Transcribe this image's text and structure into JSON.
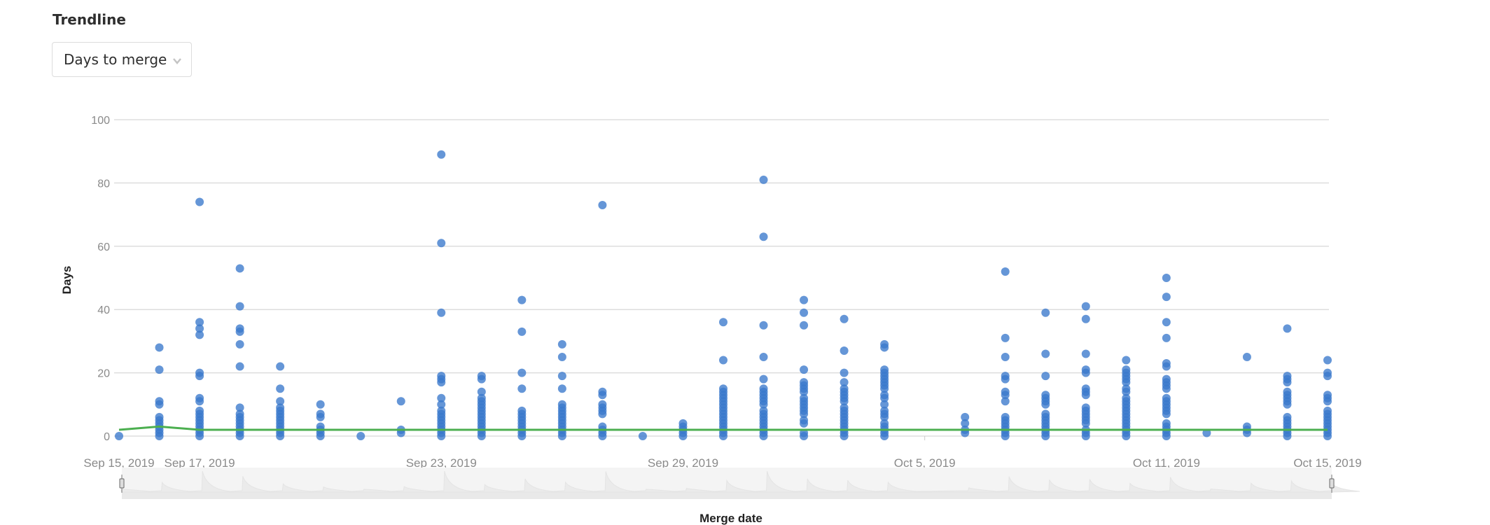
{
  "header": {
    "title": "Trendline",
    "dropdown": {
      "selected": "Days to merge",
      "icon": "chevron-down-icon"
    }
  },
  "chart_data": {
    "type": "scatter",
    "title": "",
    "xlabel": "Merge date",
    "ylabel": "Days",
    "ylim": [
      0,
      100
    ],
    "yticks": [
      0,
      20,
      40,
      60,
      80,
      100
    ],
    "xrange": [
      "2019-09-15",
      "2019-10-15"
    ],
    "xtick_labels": [
      {
        "date": "2019-09-15",
        "label": "Sep 15, 2019"
      },
      {
        "date": "2019-09-17",
        "label": "Sep 17, 2019"
      },
      {
        "date": "2019-09-23",
        "label": "Sep 23, 2019"
      },
      {
        "date": "2019-09-29",
        "label": "Sep 29, 2019"
      },
      {
        "date": "2019-10-05",
        "label": "Oct 5, 2019"
      },
      {
        "date": "2019-10-11",
        "label": "Oct 11, 2019"
      },
      {
        "date": "2019-10-15",
        "label": "Oct 15, 2019"
      }
    ],
    "grid": true,
    "colors": {
      "points": "#3a78cc",
      "trendline": "#4caf50",
      "grid": "#dddddd"
    },
    "series": [
      {
        "name": "Days to merge",
        "type": "scatter",
        "points_by_day": [
          {
            "day": 0,
            "values": [
              0
            ]
          },
          {
            "day": 1,
            "values": [
              28,
              21,
              11,
              10,
              6,
              5,
              4,
              3,
              2,
              1,
              0
            ]
          },
          {
            "day": 2,
            "values": [
              74,
              36,
              34,
              32,
              20,
              19,
              12,
              11,
              8,
              7,
              6,
              5,
              4,
              3,
              2,
              1,
              0
            ]
          },
          {
            "day": 3,
            "values": [
              53,
              41,
              34,
              33,
              29,
              22,
              9,
              7,
              6,
              5,
              4,
              3,
              2,
              1,
              0
            ]
          },
          {
            "day": 4,
            "values": [
              22,
              15,
              11,
              9,
              8,
              7,
              6,
              5,
              4,
              3,
              2,
              1,
              0
            ]
          },
          {
            "day": 5,
            "values": [
              10,
              7,
              6,
              3,
              2,
              1,
              0
            ]
          },
          {
            "day": 6,
            "values": [
              0
            ]
          },
          {
            "day": 7,
            "values": [
              11,
              2,
              1
            ]
          },
          {
            "day": 8,
            "values": [
              89,
              61,
              39,
              19,
              18,
              17,
              12,
              10,
              8,
              7,
              6,
              5,
              4,
              3,
              2,
              1,
              0
            ]
          },
          {
            "day": 9,
            "values": [
              19,
              18,
              14,
              12,
              11,
              10,
              9,
              8,
              7,
              6,
              5,
              4,
              3,
              2,
              1,
              0
            ]
          },
          {
            "day": 10,
            "values": [
              43,
              33,
              20,
              15,
              8,
              7,
              6,
              5,
              4,
              3,
              2,
              1,
              0
            ]
          },
          {
            "day": 11,
            "values": [
              29,
              25,
              19,
              15,
              10,
              9,
              8,
              7,
              6,
              5,
              4,
              3,
              2,
              1,
              0
            ]
          },
          {
            "day": 12,
            "values": [
              73,
              14,
              13,
              10,
              9,
              8,
              7,
              3,
              2,
              1,
              0
            ]
          },
          {
            "day": 13,
            "values": [
              0
            ]
          },
          {
            "day": 14,
            "values": [
              4,
              3,
              2,
              1,
              0
            ]
          },
          {
            "day": 15,
            "values": [
              36,
              24,
              15,
              14,
              13,
              12,
              11,
              10,
              9,
              8,
              7,
              6,
              5,
              4,
              3,
              2,
              1,
              0
            ]
          },
          {
            "day": 16,
            "values": [
              81,
              63,
              35,
              25,
              18,
              15,
              14,
              13,
              12,
              11,
              10,
              8,
              7,
              6,
              5,
              4,
              3,
              2,
              1,
              0
            ]
          },
          {
            "day": 17,
            "values": [
              43,
              39,
              35,
              21,
              17,
              16,
              15,
              14,
              12,
              11,
              10,
              9,
              8,
              7,
              5,
              4,
              1,
              0
            ]
          },
          {
            "day": 18,
            "values": [
              37,
              27,
              20,
              17,
              15,
              14,
              13,
              12,
              11,
              9,
              8,
              7,
              6,
              5,
              4,
              3,
              2,
              1,
              0
            ]
          },
          {
            "day": 19,
            "values": [
              29,
              28,
              21,
              20,
              19,
              18,
              17,
              16,
              15,
              13,
              12,
              10,
              8,
              7,
              6,
              4,
              3,
              2,
              1,
              0
            ]
          },
          {
            "day": 21,
            "values": [
              6,
              4,
              2,
              1
            ]
          },
          {
            "day": 22,
            "values": [
              52,
              31,
              25,
              19,
              18,
              14,
              13,
              11,
              6,
              5,
              4,
              3,
              2,
              1,
              0
            ]
          },
          {
            "day": 23,
            "values": [
              39,
              26,
              19,
              13,
              12,
              11,
              10,
              7,
              6,
              5,
              4,
              3,
              2,
              1,
              0
            ]
          },
          {
            "day": 24,
            "values": [
              41,
              37,
              26,
              21,
              20,
              15,
              14,
              13,
              9,
              8,
              7,
              6,
              5,
              4,
              2,
              1,
              0
            ]
          },
          {
            "day": 25,
            "values": [
              24,
              21,
              20,
              19,
              18,
              17,
              15,
              14,
              12,
              11,
              10,
              9,
              8,
              7,
              6,
              5,
              4,
              3,
              2,
              1,
              0
            ]
          },
          {
            "day": 26,
            "values": [
              50,
              44,
              36,
              31,
              23,
              22,
              18,
              17,
              16,
              15,
              12,
              11,
              10,
              9,
              8,
              7,
              4,
              3,
              2,
              1,
              0
            ]
          },
          {
            "day": 27,
            "values": [
              1
            ]
          },
          {
            "day": 28,
            "values": [
              25,
              3,
              2,
              1
            ]
          },
          {
            "day": 29,
            "values": [
              34,
              19,
              18,
              17,
              14,
              13,
              12,
              11,
              10,
              6,
              5,
              4,
              3,
              2,
              1,
              0
            ]
          },
          {
            "day": 30,
            "values": [
              24,
              20,
              19,
              13,
              12,
              11,
              8,
              7,
              6,
              5,
              4,
              3,
              2,
              1,
              0
            ]
          }
        ]
      },
      {
        "name": "Trendline",
        "type": "line",
        "points": [
          {
            "day": 0,
            "value": 2
          },
          {
            "day": 1,
            "value": 3
          },
          {
            "day": 2,
            "value": 2
          },
          {
            "day": 30,
            "value": 2
          }
        ]
      }
    ],
    "range_selector": {
      "from": "2019-09-15",
      "to": "2019-10-15"
    }
  }
}
